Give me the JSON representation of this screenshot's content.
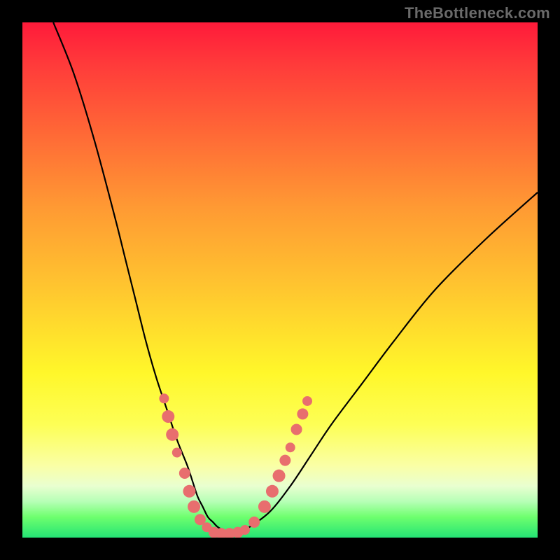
{
  "watermark": "TheBottleneck.com",
  "colors": {
    "background": "#000000",
    "curve_stroke": "#000000",
    "marker_fill": "#e86e6e",
    "marker_stroke": "#d95a5a"
  },
  "chart_data": {
    "type": "line",
    "title": "",
    "xlabel": "",
    "ylabel": "",
    "xlim": [
      0,
      100
    ],
    "ylim": [
      0,
      100
    ],
    "grid": false,
    "legend": false,
    "series": [
      {
        "name": "bottleneck-curve",
        "x": [
          6,
          10,
          14,
          18,
          20,
          22,
          24,
          26,
          28,
          30,
          32,
          33,
          34,
          35,
          36,
          37,
          38,
          40,
          42,
          44,
          48,
          52,
          56,
          60,
          66,
          72,
          80,
          90,
          100
        ],
        "y": [
          100,
          90,
          77,
          62,
          54,
          46,
          38,
          31,
          25,
          19,
          14,
          11,
          8,
          6,
          4,
          3,
          2,
          1,
          1,
          2,
          5,
          10,
          16,
          22,
          30,
          38,
          48,
          58,
          67
        ]
      }
    ],
    "markers": [
      {
        "x": 27.5,
        "y": 27.0,
        "r": 7
      },
      {
        "x": 28.3,
        "y": 23.5,
        "r": 9
      },
      {
        "x": 29.1,
        "y": 20.0,
        "r": 9
      },
      {
        "x": 30.0,
        "y": 16.5,
        "r": 7
      },
      {
        "x": 31.5,
        "y": 12.5,
        "r": 8
      },
      {
        "x": 32.4,
        "y": 9.0,
        "r": 9
      },
      {
        "x": 33.3,
        "y": 6.0,
        "r": 9
      },
      {
        "x": 34.5,
        "y": 3.5,
        "r": 8
      },
      {
        "x": 35.8,
        "y": 2.0,
        "r": 7
      },
      {
        "x": 37.2,
        "y": 1.0,
        "r": 8
      },
      {
        "x": 38.6,
        "y": 0.8,
        "r": 8
      },
      {
        "x": 40.2,
        "y": 0.8,
        "r": 8
      },
      {
        "x": 41.8,
        "y": 1.0,
        "r": 8
      },
      {
        "x": 43.2,
        "y": 1.5,
        "r": 7
      },
      {
        "x": 45.0,
        "y": 3.0,
        "r": 8
      },
      {
        "x": 47.0,
        "y": 6.0,
        "r": 9
      },
      {
        "x": 48.5,
        "y": 9.0,
        "r": 9
      },
      {
        "x": 49.8,
        "y": 12.0,
        "r": 9
      },
      {
        "x": 51.0,
        "y": 15.0,
        "r": 8
      },
      {
        "x": 52.0,
        "y": 17.5,
        "r": 7
      },
      {
        "x": 53.2,
        "y": 21.0,
        "r": 8
      },
      {
        "x": 54.4,
        "y": 24.0,
        "r": 8
      },
      {
        "x": 55.3,
        "y": 26.5,
        "r": 7
      }
    ]
  }
}
